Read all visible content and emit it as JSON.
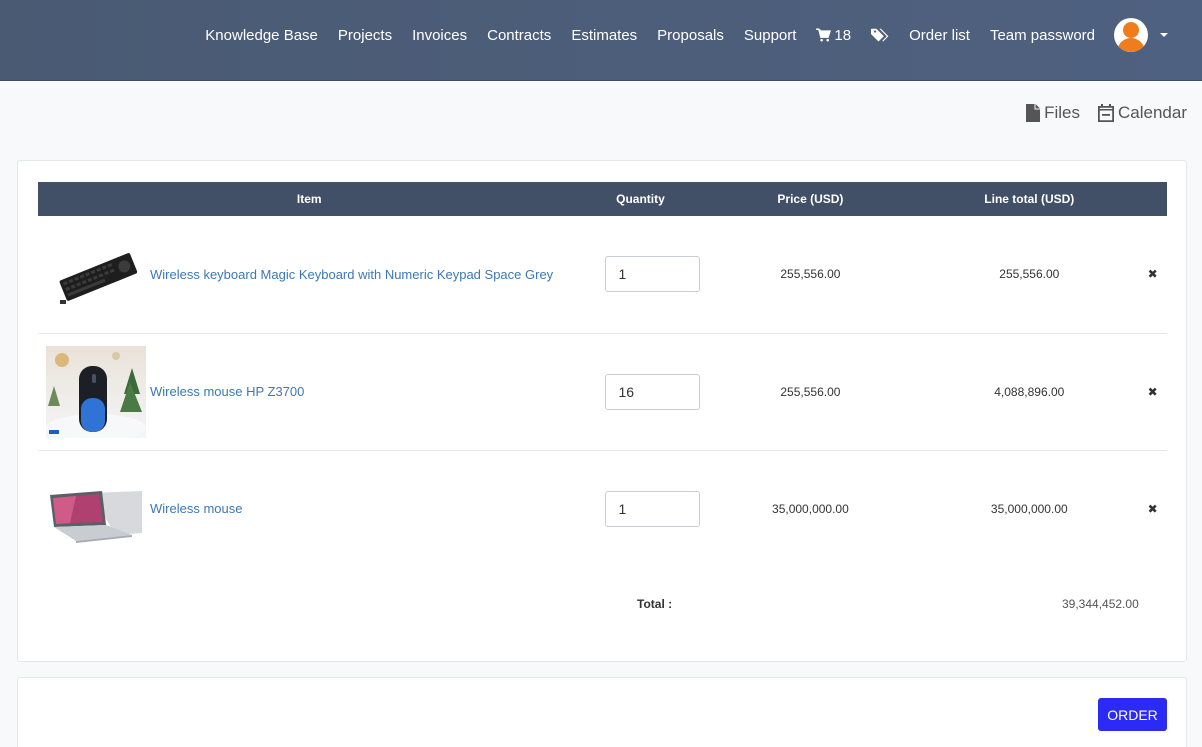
{
  "nav": {
    "items": [
      "Knowledge Base",
      "Projects",
      "Invoices",
      "Contracts",
      "Estimates",
      "Proposals",
      "Support"
    ],
    "cart_count": "18",
    "order_list": "Order list",
    "team_password": "Team password"
  },
  "sub_links": {
    "files": "Files",
    "calendar": "Calendar"
  },
  "table": {
    "headers": {
      "item": "Item",
      "quantity": "Quantity",
      "price": "Price (USD)",
      "line_total": "Line total (USD)"
    },
    "rows": [
      {
        "name": "Wireless keyboard Magic Keyboard with Numeric Keypad Space Grey",
        "quantity": "1",
        "price": "255,556.00",
        "line_total": "255,556.00",
        "image": "keyboard-image"
      },
      {
        "name": "Wireless mouse HP Z3700",
        "quantity": "16",
        "price": "255,556.00",
        "line_total": "4,088,896.00",
        "image": "mouse-image"
      },
      {
        "name": "Wireless mouse",
        "quantity": "1",
        "price": "35,000,000.00",
        "line_total": "35,000,000.00",
        "image": "laptop-image"
      }
    ]
  },
  "total": {
    "label": "Total :",
    "value": "39,344,452.00"
  },
  "order_button": "ORDER",
  "colors": {
    "navbar": "#4f6180",
    "header": "#415067",
    "link": "#3c78b5",
    "remove": "#e03b3b",
    "order": "#2b2bf5",
    "avatar": "#f07d1c"
  }
}
